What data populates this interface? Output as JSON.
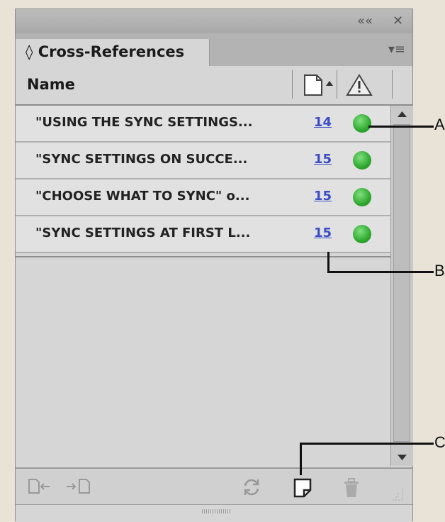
{
  "panel": {
    "title": "Cross-References",
    "title_prefix": "◊",
    "collapse_glyph": "««",
    "close_glyph": "✕",
    "menu_glyph": "▾≡"
  },
  "header": {
    "name_label": "Name"
  },
  "rows": [
    {
      "name": "\"USING THE SYNC SETTINGS...",
      "page": "14",
      "status": "ok"
    },
    {
      "name": "\"SYNC SETTINGS ON SUCCE...",
      "page": "15",
      "status": "ok"
    },
    {
      "name": "\"CHOOSE WHAT TO SYNC\" o...",
      "page": "15",
      "status": "ok"
    },
    {
      "name": "\"SYNC SETTINGS AT FIRST L...",
      "page": "15",
      "status": "ok"
    }
  ],
  "callouts": {
    "a": "A",
    "b": "B",
    "c": "C"
  },
  "colors": {
    "status_ok": "#2fa82f",
    "page_link": "#3a4cc8",
    "panel_bg": "#d6d6d6"
  },
  "icons": {
    "footer": [
      "go-to-source-icon",
      "go-to-destination-icon",
      "update-icon",
      "create-cross-reference-icon",
      "delete-icon"
    ]
  }
}
